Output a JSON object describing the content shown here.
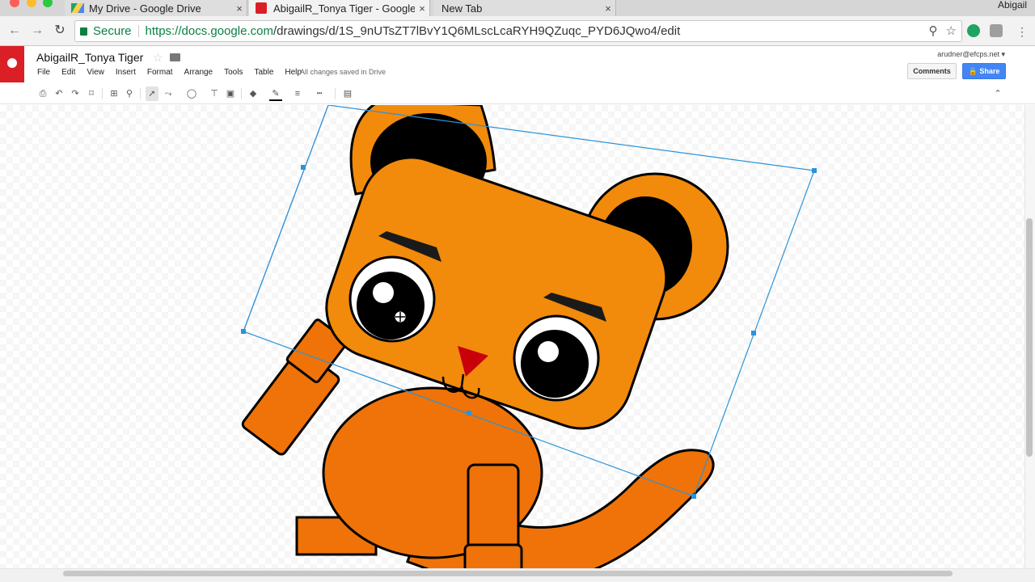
{
  "browser": {
    "tabs": [
      {
        "title": "My Drive - Google Drive",
        "close": "×"
      },
      {
        "title": "AbigailR_Tonya Tiger - Google",
        "close": "×"
      },
      {
        "title": "New Tab",
        "close": "×"
      }
    ],
    "profile": "Abigail",
    "secure_label": "Secure",
    "url_host": "https://docs.google.com",
    "url_path": "/drawings/d/1S_9nUTsZT7lBvY1Q6MLscLcaRYH9QZuqc_PYD6JQwo4/edit",
    "icons": {
      "back": "←",
      "forward": "→",
      "reload": "↻",
      "zoom": "⚲",
      "bookmark": "☆"
    }
  },
  "app": {
    "doc_title": "AbigailR_Tonya Tiger",
    "star": "☆",
    "menu": [
      "File",
      "Edit",
      "View",
      "Insert",
      "Format",
      "Arrange",
      "Tools",
      "Table",
      "Help"
    ],
    "save_status": "All changes saved in Drive",
    "user_email": "arudner@efcps.net ▾",
    "comments_label": "Comments",
    "share_label": "🔒 Share",
    "collapse": "⌃",
    "toolbar_icons": {
      "print": "⎙",
      "undo": "↶",
      "redo": "↷",
      "paint": "⌑",
      "fit": "⊞",
      "zoom": "⚲",
      "select": "➚",
      "line": "⤳",
      "shape": "◯",
      "textbox": "⊤",
      "image": "▣",
      "fill": "◆",
      "pen": "✎",
      "weight": "≡",
      "dash": "┅",
      "comment": "▤"
    }
  },
  "colors": {
    "accent_blue": "#4285f4",
    "logo_red": "#db1f26",
    "tiger_head": "#f28a0b",
    "tiger_body": "#ef7308",
    "selection": "#2d93d9",
    "nose": "#c8000a"
  }
}
